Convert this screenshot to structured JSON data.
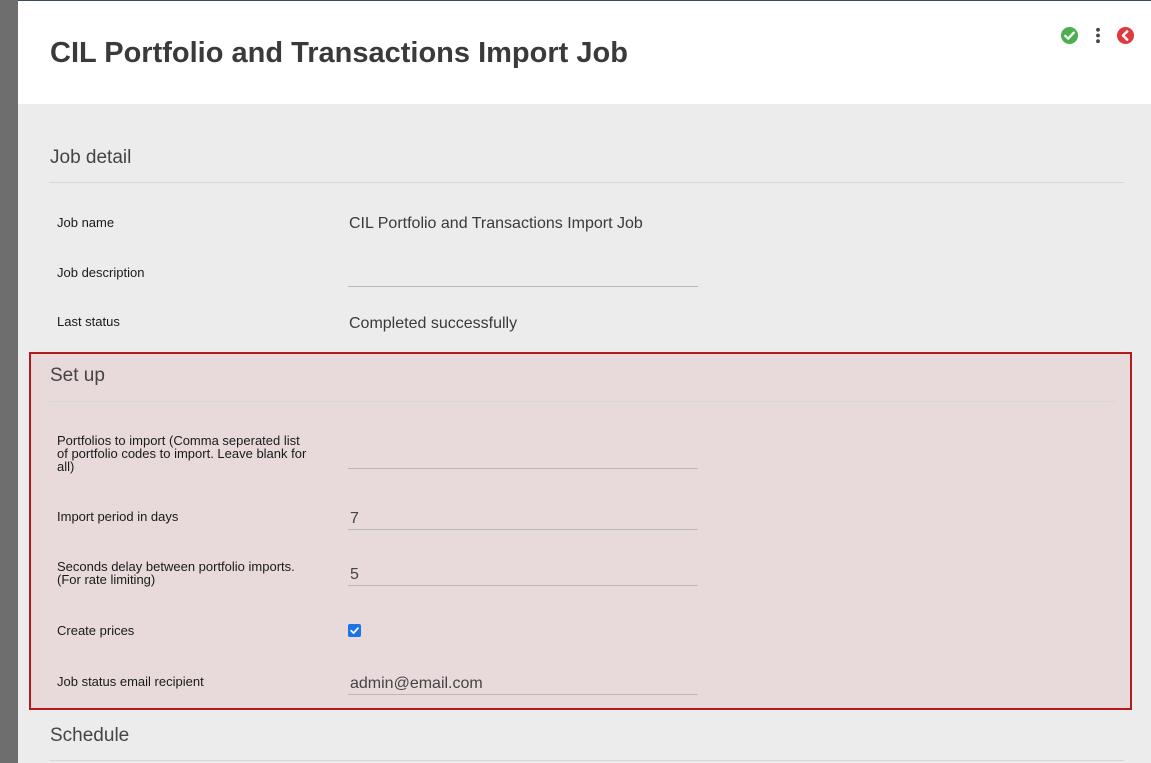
{
  "header": {
    "title": "CIL Portfolio and Transactions Import Job",
    "accent_color": "#b31b1b"
  },
  "actions": {
    "save_icon": "check-circle-icon",
    "menu_icon": "kebab-menu-icon",
    "back_icon": "back-arrow-icon"
  },
  "job_detail": {
    "section_title": "Job detail",
    "job_name_label": "Job name",
    "job_name_value": "CIL Portfolio and Transactions Import Job",
    "job_description_label": "Job description",
    "job_description_value": "",
    "last_status_label": "Last status",
    "last_status_value": "Completed successfully"
  },
  "setup": {
    "section_title": "Set up",
    "portfolios_label": "Portfolios to import (Comma seperated list of portfolio codes to import. Leave blank for all)",
    "portfolios_value": "",
    "import_period_label": "Import period in days",
    "import_period_value": "7",
    "delay_label": "Seconds delay between portfolio imports. (For rate limiting)",
    "delay_value": "5",
    "create_prices_label": "Create prices",
    "create_prices_checked": true,
    "email_label": "Job status email recipient",
    "email_value": "admin@email.com"
  },
  "schedule": {
    "section_title": "Schedule"
  }
}
